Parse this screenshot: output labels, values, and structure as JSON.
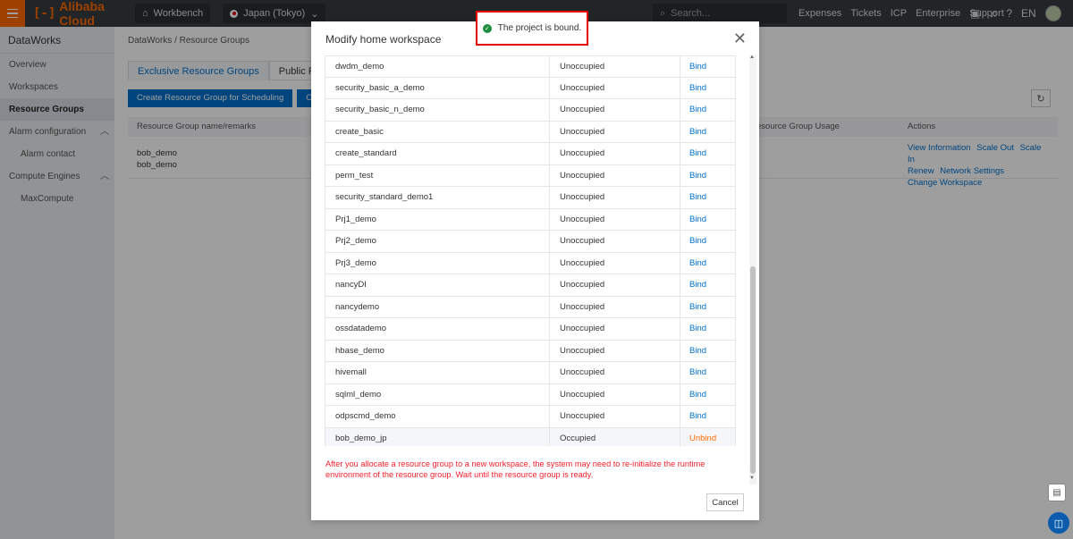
{
  "topbar": {
    "brand": "Alibaba Cloud",
    "brand_mark": "[-]",
    "workbench": "Workbench",
    "region": "Japan (Tokyo)",
    "search_placeholder": "Search...",
    "links": [
      "Expenses",
      "Tickets",
      "ICP",
      "Enterprise",
      "Support"
    ],
    "lang": "EN",
    "accent_color": "#ff6a00"
  },
  "sidebar": {
    "title": "DataWorks",
    "items": [
      {
        "label": "Overview"
      },
      {
        "label": "Workspaces"
      },
      {
        "label": "Resource Groups"
      },
      {
        "label": "Alarm configuration"
      },
      {
        "label": "Alarm contact"
      },
      {
        "label": "Compute Engines"
      },
      {
        "label": "MaxCompute"
      }
    ]
  },
  "main": {
    "breadcrumb": [
      "DataWorks",
      "/",
      "Resource Groups"
    ],
    "tabs": [
      "Exclusive Resource Groups",
      "Public Resource Gr"
    ],
    "buttons": [
      "Create Resource Group for Scheduling",
      "Create Reso"
    ],
    "columns": [
      "Resource Group name/remarks",
      "esource Group Usage",
      "Actions"
    ],
    "row": {
      "name": "bob_demo",
      "remark": "bob_demo",
      "actions": [
        "View Information",
        "Scale Out",
        "Scale In",
        "Renew",
        "Network Settings",
        "Change Workspace"
      ]
    }
  },
  "modal": {
    "title": "Modify home workspace",
    "rows": [
      {
        "name": "dwdm_demo",
        "status": "Unoccupied",
        "action": "Bind"
      },
      {
        "name": "security_basic_a_demo",
        "status": "Unoccupied",
        "action": "Bind"
      },
      {
        "name": "security_basic_n_demo",
        "status": "Unoccupied",
        "action": "Bind"
      },
      {
        "name": "create_basic",
        "status": "Unoccupied",
        "action": "Bind"
      },
      {
        "name": "create_standard",
        "status": "Unoccupied",
        "action": "Bind"
      },
      {
        "name": "perm_test",
        "status": "Unoccupied",
        "action": "Bind"
      },
      {
        "name": "security_standard_demo1",
        "status": "Unoccupied",
        "action": "Bind"
      },
      {
        "name": "Prj1_demo",
        "status": "Unoccupied",
        "action": "Bind"
      },
      {
        "name": "Prj2_demo",
        "status": "Unoccupied",
        "action": "Bind"
      },
      {
        "name": "Prj3_demo",
        "status": "Unoccupied",
        "action": "Bind"
      },
      {
        "name": "nancyDI",
        "status": "Unoccupied",
        "action": "Bind"
      },
      {
        "name": "nancydemo",
        "status": "Unoccupied",
        "action": "Bind"
      },
      {
        "name": "ossdatademo",
        "status": "Unoccupied",
        "action": "Bind"
      },
      {
        "name": "hbase_demo",
        "status": "Unoccupied",
        "action": "Bind"
      },
      {
        "name": "hivemall",
        "status": "Unoccupied",
        "action": "Bind"
      },
      {
        "name": "sqlml_demo",
        "status": "Unoccupied",
        "action": "Bind"
      },
      {
        "name": "odpscmd_demo",
        "status": "Unoccupied",
        "action": "Bind"
      },
      {
        "name": "bob_demo_jp",
        "status": "Occupied",
        "action": "Unbind"
      }
    ],
    "warning": "After you allocate a resource group to a new workspace, the system may need to re-initialize the runtime environment of the resource group. Wait until the resource group is ready.",
    "cancel_label": "Cancel"
  },
  "toast": {
    "message": "The project is bound.",
    "status_color": "#1e8e3e"
  }
}
